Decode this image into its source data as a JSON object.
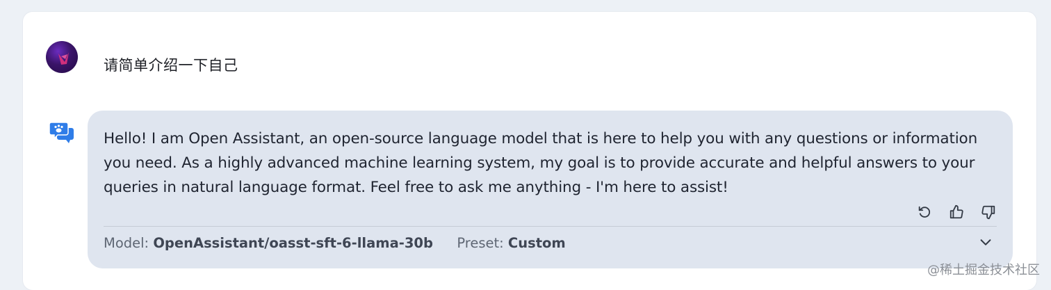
{
  "conversation": {
    "user_message": "请简单介绍一下自己",
    "assistant_message": "Hello! I am Open Assistant, an open-source language model that is here to help you with any questions or information you need. As a highly advanced machine learning system, my goal is to provide accurate and helpful answers to your queries in natural language format. Feel free to ask me anything - I'm here to assist!",
    "model_label": "Model:",
    "model_value": "OpenAssistant/oasst-sft-6-llama-30b",
    "preset_label": "Preset:",
    "preset_value": "Custom"
  },
  "icons": {
    "user_avatar": "user-avatar",
    "assistant": "assistant-chat-icon",
    "retry": "retry-icon",
    "like": "thumbs-up-icon",
    "dislike": "thumbs-down-icon",
    "expand": "chevron-down-icon"
  },
  "colors": {
    "page_background": "#edf1f6",
    "card": "#ffffff",
    "bubble": "#dfe5ef",
    "assistant_icon": "#2f7de8"
  },
  "watermark": "@稀土掘金技术社区"
}
